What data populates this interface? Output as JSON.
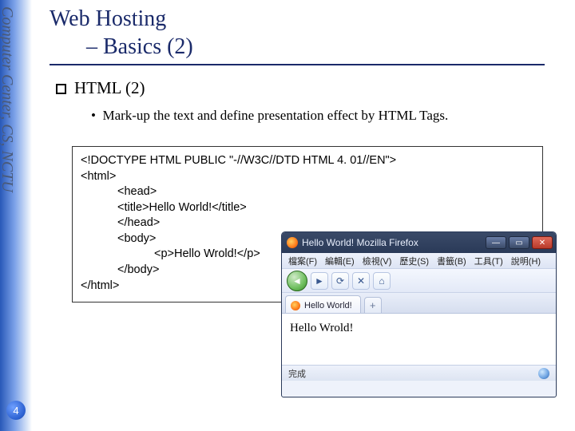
{
  "sidebar": {
    "label": "Computer Center, CS, NCTU"
  },
  "page_number": "4",
  "title": {
    "line1": "Web Hosting",
    "line2": "– Basics (2)"
  },
  "section": {
    "heading": "HTML (2)",
    "bullet": "Mark-up the text and define presentation effect by HTML Tags."
  },
  "code": {
    "l1": "<!DOCTYPE HTML PUBLIC \"-//W3C//DTD HTML 4. 01//EN\">",
    "l2": "<html>",
    "l3": "<head>",
    "l4": "<title>Hello World!</title>",
    "l5": "</head>",
    "l6": "<body>",
    "l7": "<p>Hello Wrold!</p>",
    "l8": "</body>",
    "l9": "</html>"
  },
  "firefox": {
    "window_title": "Hello World!  Mozilla Firefox",
    "menu": {
      "file": "檔案(F)",
      "edit": "編輯(E)",
      "view": "檢視(V)",
      "history": "歷史(S)",
      "bookmarks": "書籤(B)",
      "tools": "工具(T)",
      "help": "說明(H)"
    },
    "tab_label": "Hello World!",
    "page_text": "Hello Wrold!",
    "status": "完成"
  }
}
